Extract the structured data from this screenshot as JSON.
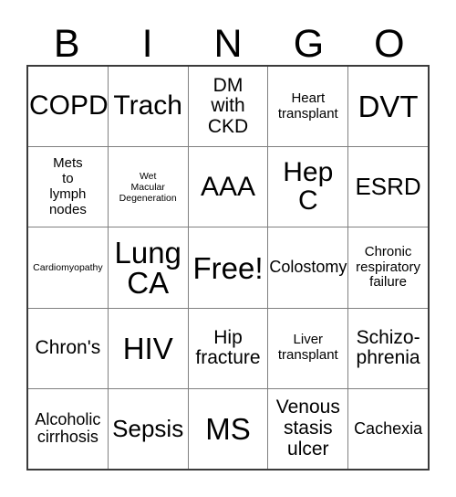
{
  "card": {
    "title": "Bingo Card",
    "header_letters": [
      "B",
      "I",
      "N",
      "G",
      "O"
    ],
    "colors": {
      "background": "#ffffff",
      "text": "#000000",
      "outer_border": "#3b3b3b",
      "grid_line": "#808080"
    },
    "free_space": "Free!",
    "rows": [
      [
        {
          "text": "COPD",
          "size": "fs-2xl"
        },
        {
          "text": "Trach",
          "size": "fs-2xl"
        },
        {
          "text": "DM\nwith\nCKD",
          "size": "fs-lg"
        },
        {
          "text": "Heart\ntransplant",
          "size": "fs-sm"
        },
        {
          "text": "DVT",
          "size": "fs-3xl"
        }
      ],
      [
        {
          "text": "Mets\nto\nlymph\nnodes",
          "size": "fs-sm"
        },
        {
          "text": "Wet\nMacular\nDegeneration",
          "size": "fs-xs"
        },
        {
          "text": "AAA",
          "size": "fs-2xl"
        },
        {
          "text": "Hep\nC",
          "size": "fs-2xl"
        },
        {
          "text": "ESRD",
          "size": "fs-xl"
        }
      ],
      [
        {
          "text": "Cardiomyopathy",
          "size": "fs-xs"
        },
        {
          "text": "Lung\nCA",
          "size": "fs-3xl"
        },
        {
          "text": "Free!",
          "size": "fs-3xl"
        },
        {
          "text": "Colostomy",
          "size": "fs-md"
        },
        {
          "text": "Chronic\nrespiratory\nfailure",
          "size": "fs-sm"
        }
      ],
      [
        {
          "text": "Chron's",
          "size": "fs-lg"
        },
        {
          "text": "HIV",
          "size": "fs-3xl"
        },
        {
          "text": "Hip\nfracture",
          "size": "fs-lg"
        },
        {
          "text": "Liver\ntransplant",
          "size": "fs-sm"
        },
        {
          "text": "Schizo-\nphrenia",
          "size": "fs-lg"
        }
      ],
      [
        {
          "text": "Alcoholic\ncirrhosis",
          "size": "fs-md"
        },
        {
          "text": "Sepsis",
          "size": "fs-xl"
        },
        {
          "text": "MS",
          "size": "fs-3xl"
        },
        {
          "text": "Venous\nstasis\nulcer",
          "size": "fs-lg"
        },
        {
          "text": "Cachexia",
          "size": "fs-md"
        }
      ]
    ]
  }
}
